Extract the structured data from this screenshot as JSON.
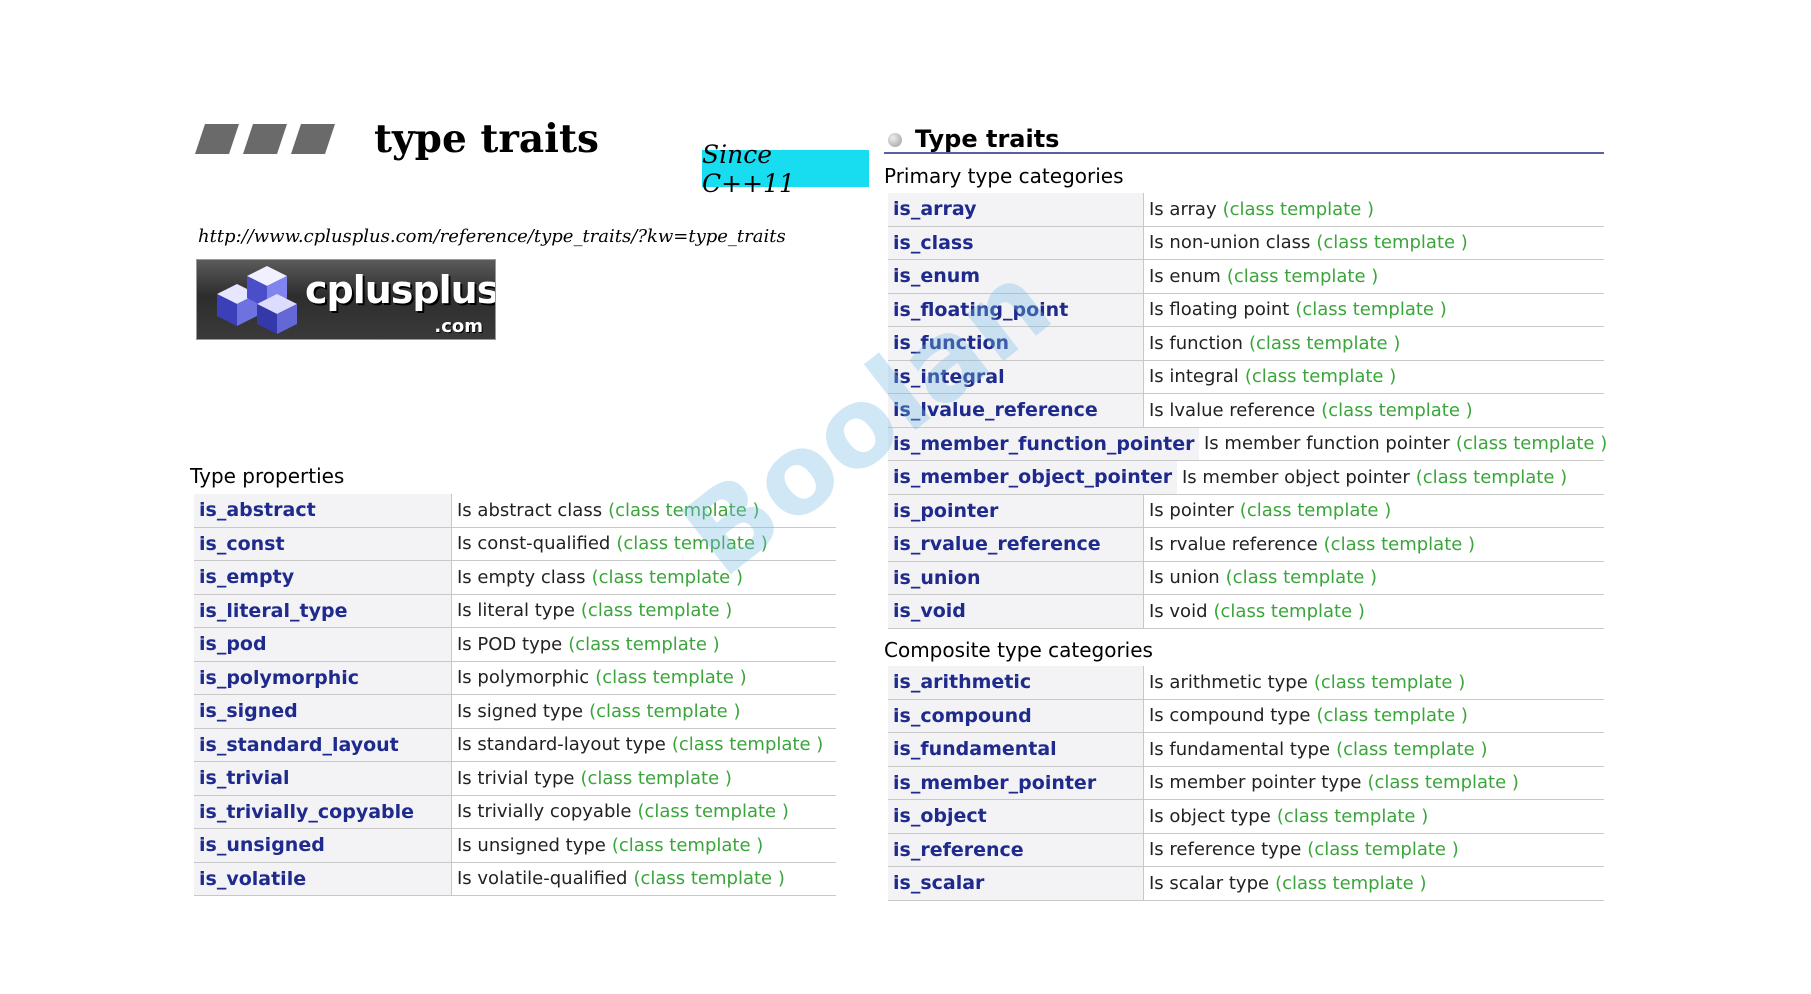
{
  "header": {
    "title": "type traits",
    "badge": "Since C++11",
    "url": "http://www.cplusplus.com/reference/type_traits/?kw=type_traits",
    "logo_text": "cplusplus",
    "logo_suffix": ".com"
  },
  "right_panel": {
    "title": "Type traits"
  },
  "colors": {
    "badge_bg": "#18ddf0",
    "keyword": "#1e2a8c",
    "class_template": "#3aa53a",
    "rule": "#5560a8"
  },
  "tag_text": "(class template )",
  "type_properties": {
    "heading": "Type properties",
    "rows": [
      {
        "name": "is_abstract",
        "desc": "Is abstract class"
      },
      {
        "name": "is_const",
        "desc": "Is const-qualified"
      },
      {
        "name": "is_empty",
        "desc": "Is empty class"
      },
      {
        "name": "is_literal_type",
        "desc": "Is literal type"
      },
      {
        "name": "is_pod",
        "desc": "Is POD type"
      },
      {
        "name": "is_polymorphic",
        "desc": "Is polymorphic"
      },
      {
        "name": "is_signed",
        "desc": "Is signed type"
      },
      {
        "name": "is_standard_layout",
        "desc": "Is standard-layout type"
      },
      {
        "name": "is_trivial",
        "desc": "Is trivial type"
      },
      {
        "name": "is_trivially_copyable",
        "desc": "Is trivially copyable"
      },
      {
        "name": "is_unsigned",
        "desc": "Is unsigned type"
      },
      {
        "name": "is_volatile",
        "desc": "Is volatile-qualified"
      }
    ]
  },
  "primary_categories": {
    "heading": "Primary type categories",
    "rows": [
      {
        "name": "is_array",
        "desc": "Is array"
      },
      {
        "name": "is_class",
        "desc": "Is non-union class"
      },
      {
        "name": "is_enum",
        "desc": "Is enum"
      },
      {
        "name": "is_floating_point",
        "desc": "Is floating point"
      },
      {
        "name": "is_function",
        "desc": "Is function"
      },
      {
        "name": "is_integral",
        "desc": "Is integral"
      },
      {
        "name": "is_lvalue_reference",
        "desc": "Is lvalue reference"
      },
      {
        "name": "is_member_function_pointer",
        "desc": "Is member function pointer"
      },
      {
        "name": "is_member_object_pointer",
        "desc": "Is member object pointer"
      },
      {
        "name": "is_pointer",
        "desc": "Is pointer"
      },
      {
        "name": "is_rvalue_reference",
        "desc": "Is rvalue reference"
      },
      {
        "name": "is_union",
        "desc": "Is union"
      },
      {
        "name": "is_void",
        "desc": "Is void"
      }
    ]
  },
  "composite_categories": {
    "heading": "Composite type categories",
    "rows": [
      {
        "name": "is_arithmetic",
        "desc": "Is arithmetic type"
      },
      {
        "name": "is_compound",
        "desc": "Is compound type"
      },
      {
        "name": "is_fundamental",
        "desc": "Is fundamental type"
      },
      {
        "name": "is_member_pointer",
        "desc": "Is member pointer type"
      },
      {
        "name": "is_object",
        "desc": "Is object type"
      },
      {
        "name": "is_reference",
        "desc": "Is reference type"
      },
      {
        "name": "is_scalar",
        "desc": "Is scalar type"
      }
    ]
  }
}
